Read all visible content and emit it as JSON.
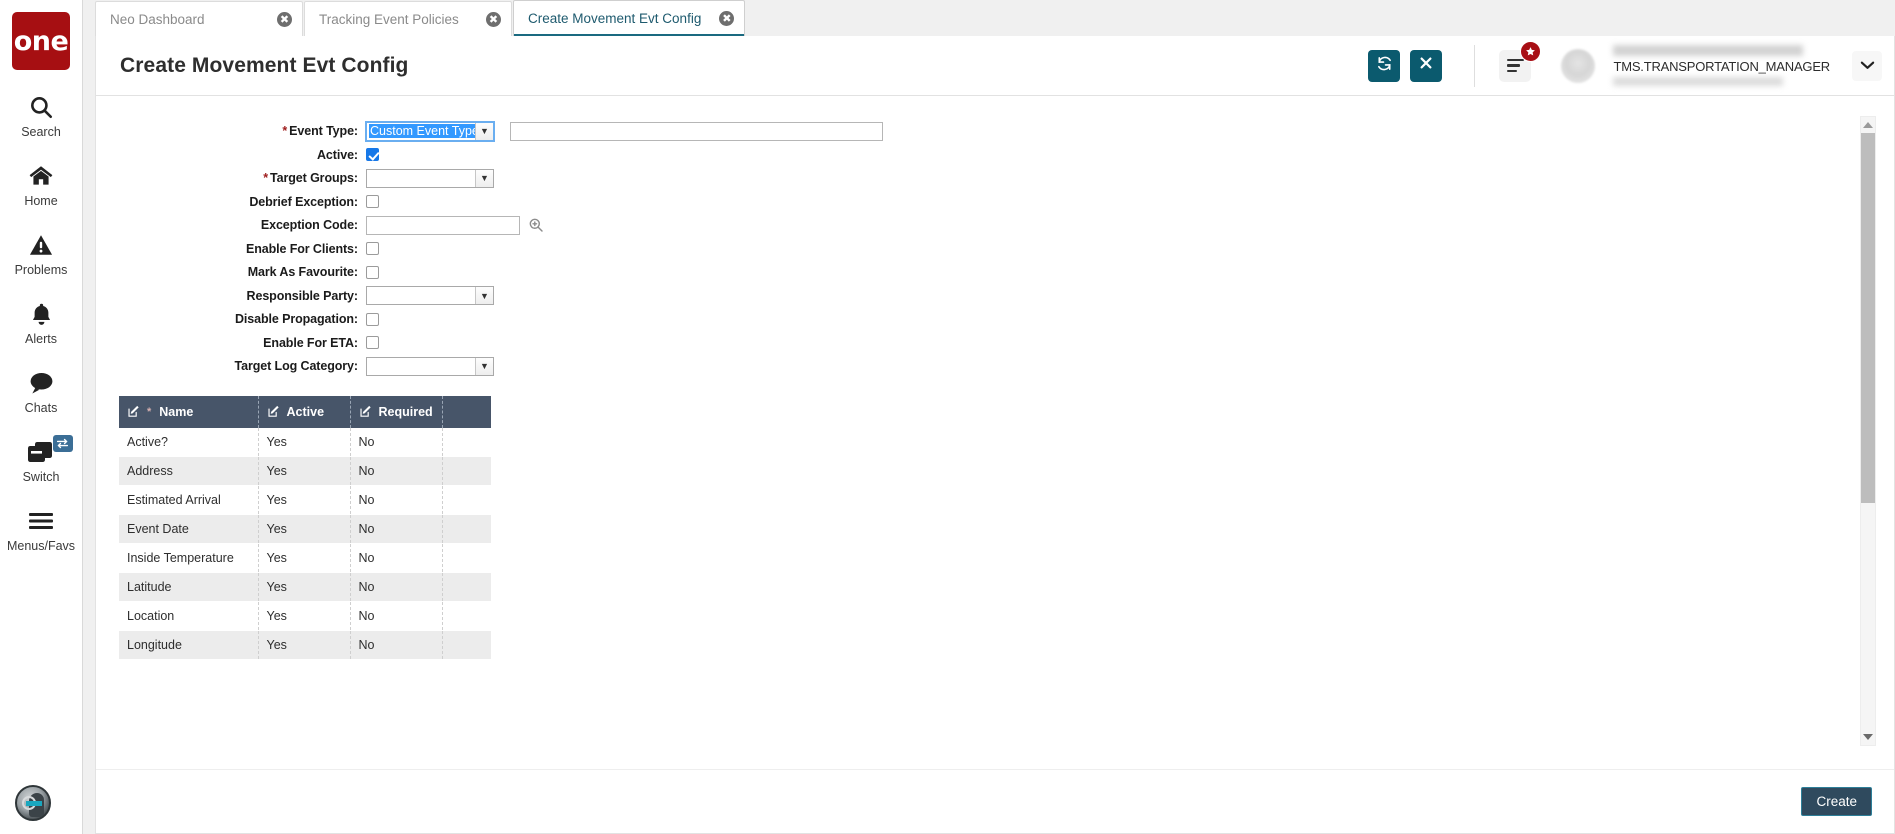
{
  "sidebar": {
    "logo_text": "one",
    "items": [
      {
        "label": "Search",
        "icon": "search-icon"
      },
      {
        "label": "Home",
        "icon": "home-icon"
      },
      {
        "label": "Problems",
        "icon": "warning-triangle-icon"
      },
      {
        "label": "Alerts",
        "icon": "bell-icon"
      },
      {
        "label": "Chats",
        "icon": "chat-bubble-icon"
      },
      {
        "label": "Switch",
        "icon": "windows-stack-icon",
        "badge_icon": "swap-arrows-icon"
      },
      {
        "label": "Menus/Favs",
        "icon": "hamburger-icon"
      }
    ]
  },
  "tabs": [
    {
      "label": "Neo Dashboard",
      "active": false
    },
    {
      "label": "Tracking Event Policies",
      "active": false
    },
    {
      "label": "Create Movement Evt Config",
      "active": true
    }
  ],
  "header": {
    "title": "Create Movement Evt Config",
    "refresh_icon": "refresh-icon",
    "close_icon": "close-x-icon",
    "menu_icon": "hamburger-menu-icon",
    "favorite_badge_icon": "star-icon",
    "user_role": "TMS.TRANSPORTATION_MANAGER",
    "user_caret_icon": "chevron-down-icon",
    "accent_color": "#0b5a6e",
    "badge_color": "#a80f15"
  },
  "form": {
    "fields": [
      {
        "label": "Event Type",
        "required": true,
        "type": "select-with-text",
        "value": "Custom Event Type",
        "text_value": ""
      },
      {
        "label": "Active",
        "required": false,
        "type": "checkbox",
        "checked": true
      },
      {
        "label": "Target Groups",
        "required": true,
        "type": "select",
        "value": ""
      },
      {
        "label": "Debrief Exception",
        "required": false,
        "type": "checkbox",
        "checked": false
      },
      {
        "label": "Exception Code",
        "required": false,
        "type": "text-lookup",
        "value": "",
        "lookup_icon": "magnifier-plus-icon"
      },
      {
        "label": "Enable For Clients",
        "required": false,
        "type": "checkbox",
        "checked": false
      },
      {
        "label": "Mark As Favourite",
        "required": false,
        "type": "checkbox",
        "checked": false
      },
      {
        "label": "Responsible Party",
        "required": false,
        "type": "select",
        "value": ""
      },
      {
        "label": "Disable Propagation",
        "required": false,
        "type": "checkbox",
        "checked": false
      },
      {
        "label": "Enable For ETA",
        "required": false,
        "type": "checkbox",
        "checked": false
      },
      {
        "label": "Target Log Category",
        "required": false,
        "type": "select",
        "value": ""
      }
    ]
  },
  "table": {
    "columns": [
      {
        "label": "Name",
        "required": true,
        "edit_icon": "pencil-square-icon"
      },
      {
        "label": "Active",
        "required": false,
        "edit_icon": "pencil-square-icon"
      },
      {
        "label": "Required",
        "required": false,
        "edit_icon": "pencil-square-icon"
      },
      {
        "label": "",
        "required": false,
        "edit_icon": ""
      }
    ],
    "rows": [
      {
        "name": "Active?",
        "active": "Yes",
        "required": "No"
      },
      {
        "name": "Address",
        "active": "Yes",
        "required": "No"
      },
      {
        "name": "Estimated Arrival",
        "active": "Yes",
        "required": "No"
      },
      {
        "name": "Event Date",
        "active": "Yes",
        "required": "No"
      },
      {
        "name": "Inside Temperature",
        "active": "Yes",
        "required": "No"
      },
      {
        "name": "Latitude",
        "active": "Yes",
        "required": "No"
      },
      {
        "name": "Location",
        "active": "Yes",
        "required": "No"
      },
      {
        "name": "Longitude",
        "active": "Yes",
        "required": "No"
      }
    ]
  },
  "footer": {
    "create_label": "Create"
  }
}
